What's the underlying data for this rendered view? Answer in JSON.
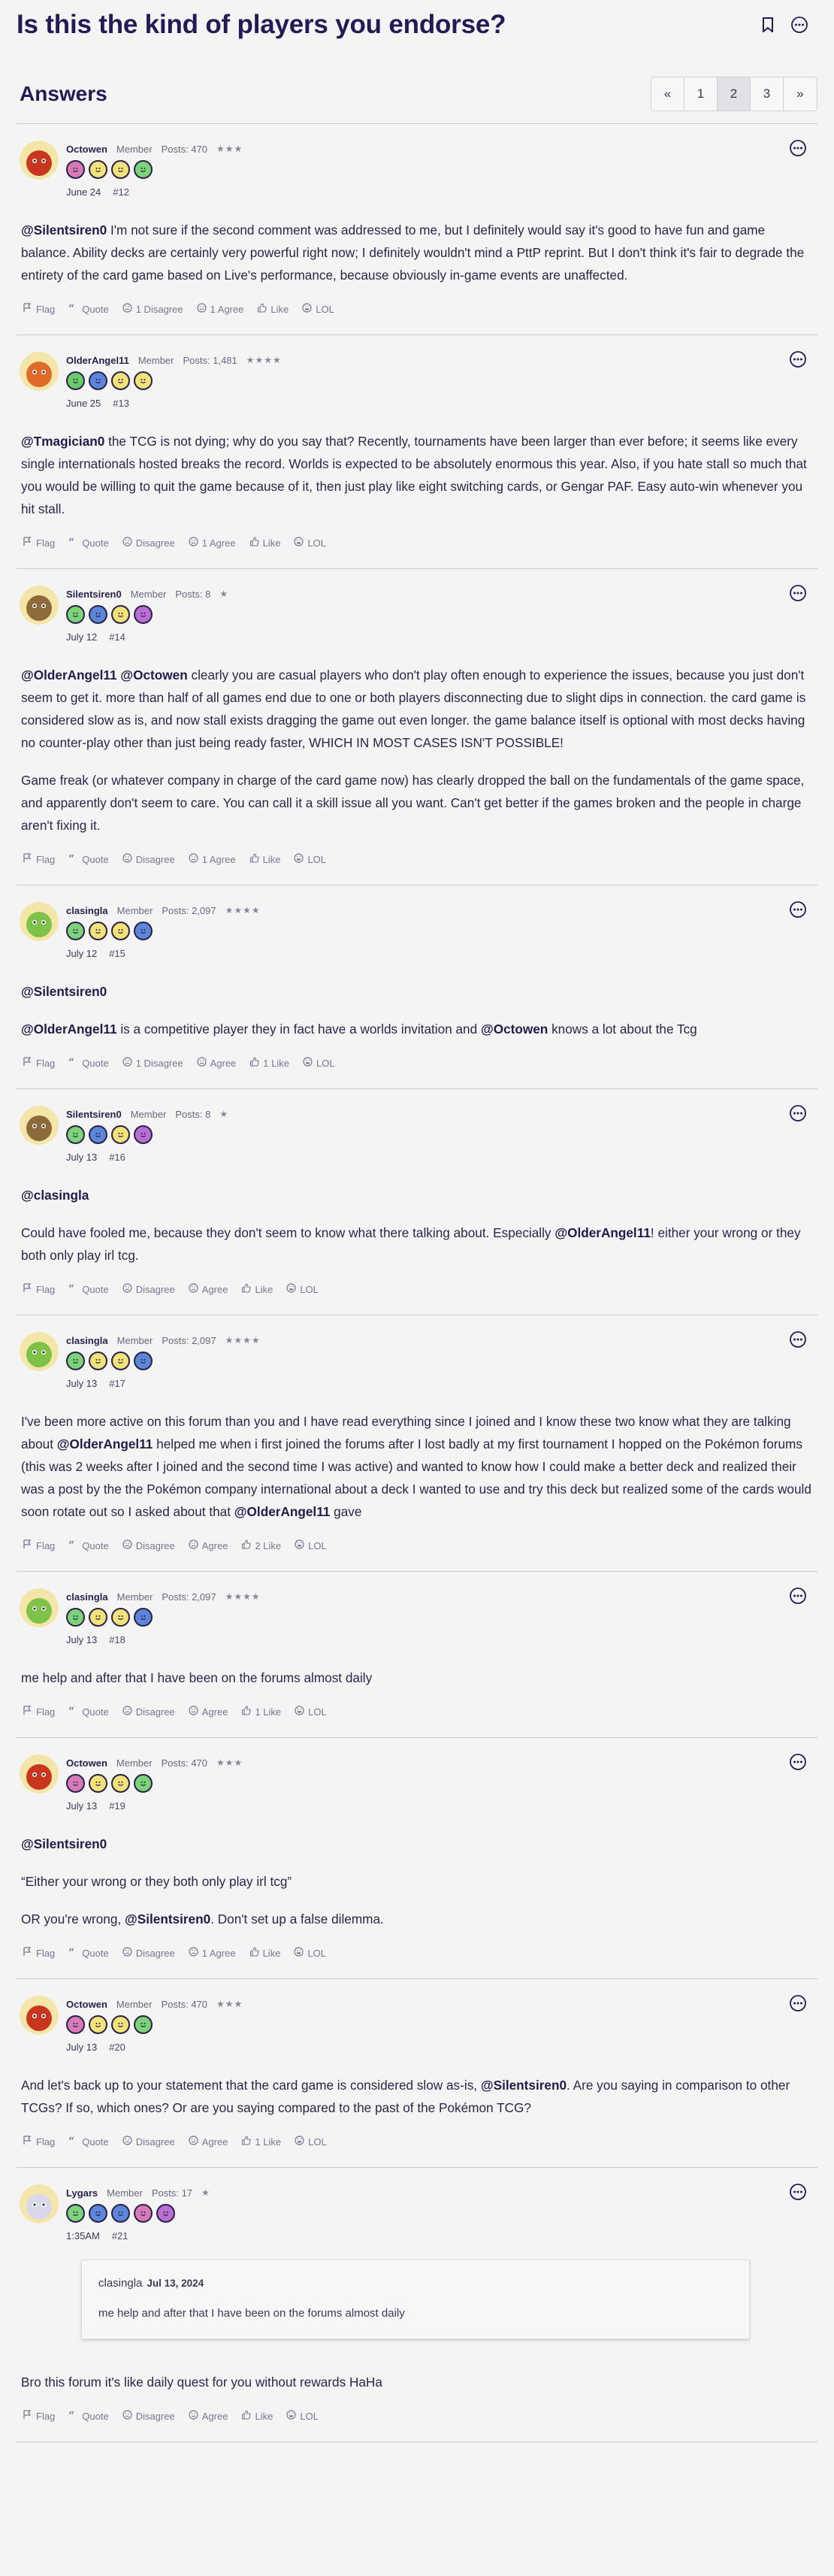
{
  "page": {
    "title": "Is this the kind of players you endorse?",
    "bookmark_icon": "bookmark-icon",
    "more_icon": "more-icon"
  },
  "answers": {
    "heading": "Answers",
    "pager": [
      "«",
      "1",
      "2",
      "3",
      "»"
    ],
    "current_page": "2"
  },
  "colors": {
    "accent": "#261a55",
    "background": "#f4f4f5"
  },
  "posts": [
    {
      "user": "Octowen",
      "role": "Member",
      "posts": "Posts: 470",
      "stars": "★★★",
      "badges": [
        "#d67ab8",
        "#f1e27a",
        "#f1e27a",
        "#7bd37a"
      ],
      "date": "June 24",
      "num": "#12",
      "avatar": "#c9361e",
      "paras": [
        [
          {
            "m": "@Silentsiren0"
          },
          {
            "t": " I'm not sure if the second comment was addressed to me, but I definitely would say it's good to have fun and game balance. Ability decks are certainly very powerful right now; I definitely wouldn't mind a PttP reprint. But I don't think it's fair to degrade the entirety of the card game based on Live's performance, because obviously in-game events are unaffected."
          }
        ]
      ],
      "actions": [
        "Flag",
        "Quote",
        "1 Disagree",
        "1 Agree",
        "Like",
        "LOL"
      ]
    },
    {
      "user": "OlderAngel11",
      "role": "Member",
      "posts": "Posts: 1,481",
      "stars": "★★★★",
      "badges": [
        "#6acb6a",
        "#5b86d9",
        "#f1e27a",
        "#f1e27a"
      ],
      "date": "June 25",
      "num": "#13",
      "avatar": "#e06a2a",
      "paras": [
        [
          {
            "m": "@Tmagician0"
          },
          {
            "t": " the TCG is not dying; why do you say that? Recently, tournaments have been larger than ever before; it seems like every single internationals hosted breaks the record. Worlds is expected to be absolutely enormous this year. Also, if you hate stall so much that you would be willing to quit the game because of it, then just play like eight switching cards, or Gengar PAF. Easy auto-win whenever you hit stall."
          }
        ]
      ],
      "actions": [
        "Flag",
        "Quote",
        "Disagree",
        "1 Agree",
        "Like",
        "LOL"
      ]
    },
    {
      "user": "Silentsiren0",
      "role": "Member",
      "posts": "Posts: 8",
      "stars": "★",
      "badges": [
        "#7bd37a",
        "#5b86d9",
        "#f1e27a",
        "#b96ed3"
      ],
      "date": "July 12",
      "num": "#14",
      "avatar": "#8c6a3a",
      "paras": [
        [
          {
            "m": "@OlderAngel11"
          },
          {
            "t": " "
          },
          {
            "m": "@Octowen"
          },
          {
            "t": " clearly you are casual players who don't play often enough to experience the issues, because you just don't seem to get it. more than half of all games end due to one or both players disconnecting due to slight dips in connection. the card game is considered slow as is, and now stall exists dragging the game out even longer. the game balance itself is optional with most decks having no counter-play other than just being ready faster, WHICH IN MOST CASES ISN'T POSSIBLE!"
          }
        ],
        [
          {
            "t": "Game freak (or whatever company in charge of the card game now) has clearly dropped the ball on the fundamentals of the game space, and apparently don't seem to care. You can call it a skill issue all you want. Can't get better if the games broken and the people in charge aren't fixing it."
          }
        ]
      ],
      "actions": [
        "Flag",
        "Quote",
        "Disagree",
        "1 Agree",
        "Like",
        "LOL"
      ]
    },
    {
      "user": "clasingla",
      "role": "Member",
      "posts": "Posts: 2,097",
      "stars": "★★★★",
      "badges": [
        "#7bd37a",
        "#f1e27a",
        "#f1e27a",
        "#5b86d9"
      ],
      "date": "July 12",
      "num": "#15",
      "avatar": "#7fc24a",
      "paras": [
        [
          {
            "m": "@Silentsiren0"
          }
        ],
        [
          {
            "m": "@OlderAngel11"
          },
          {
            "t": " is a competitive player they in fact have a worlds invitation and "
          },
          {
            "m": "@Octowen"
          },
          {
            "t": " knows a lot about the Tcg"
          }
        ]
      ],
      "actions": [
        "Flag",
        "Quote",
        "1 Disagree",
        "Agree",
        "1 Like",
        "LOL"
      ]
    },
    {
      "user": "Silentsiren0",
      "role": "Member",
      "posts": "Posts: 8",
      "stars": "★",
      "badges": [
        "#7bd37a",
        "#5b86d9",
        "#f1e27a",
        "#b96ed3"
      ],
      "date": "July 13",
      "num": "#16",
      "avatar": "#8c6a3a",
      "paras": [
        [
          {
            "m": "@clasingla"
          }
        ],
        [
          {
            "t": "Could have fooled me, because they don't seem to know what there talking about. Especially "
          },
          {
            "m": "@OlderAngel11"
          },
          {
            "t": "! either your wrong or they both only play irl tcg."
          }
        ]
      ],
      "actions": [
        "Flag",
        "Quote",
        "Disagree",
        "Agree",
        "Like",
        "LOL"
      ]
    },
    {
      "user": "clasingla",
      "role": "Member",
      "posts": "Posts: 2,097",
      "stars": "★★★★",
      "badges": [
        "#7bd37a",
        "#f1e27a",
        "#f1e27a",
        "#5b86d9"
      ],
      "date": "July 13",
      "num": "#17",
      "avatar": "#7fc24a",
      "paras": [
        [
          {
            "t": "I've been more active on this forum than you and I have read everything since I joined and I know these two know what they are talking about "
          },
          {
            "m": "@OlderAngel11"
          },
          {
            "t": " helped me when i first joined the forums after I lost badly at my first tournament I hopped on the Pokémon forums (this was 2 weeks after I joined and the second time I was active) and wanted to know how I could make a better deck and realized their was a post by the the Pokémon company international about a deck I wanted to use and try this deck but realized some of the cards would soon rotate out so I asked about that "
          },
          {
            "m": "@OlderAngel11"
          },
          {
            "t": " gave"
          }
        ]
      ],
      "actions": [
        "Flag",
        "Quote",
        "Disagree",
        "Agree",
        "2 Like",
        "LOL"
      ]
    },
    {
      "user": "clasingla",
      "role": "Member",
      "posts": "Posts: 2,097",
      "stars": "★★★★",
      "badges": [
        "#7bd37a",
        "#f1e27a",
        "#f1e27a",
        "#5b86d9"
      ],
      "date": "July 13",
      "num": "#18",
      "avatar": "#7fc24a",
      "paras": [
        [
          {
            "t": "me help and after that I have been on the forums almost daily"
          }
        ]
      ],
      "actions": [
        "Flag",
        "Quote",
        "Disagree",
        "Agree",
        "1 Like",
        "LOL"
      ]
    },
    {
      "user": "Octowen",
      "role": "Member",
      "posts": "Posts: 470",
      "stars": "★★★",
      "badges": [
        "#d67ab8",
        "#f1e27a",
        "#f1e27a",
        "#7bd37a"
      ],
      "date": "July 13",
      "num": "#19",
      "avatar": "#c9361e",
      "paras": [
        [
          {
            "m": "@Silentsiren0"
          }
        ],
        [
          {
            "t": "“Either your wrong or they both only play irl tcg”"
          }
        ],
        [
          {
            "t": "OR you're wrong, "
          },
          {
            "m": "@Silentsiren0"
          },
          {
            "t": ". Don't set up a false dilemma."
          }
        ]
      ],
      "actions": [
        "Flag",
        "Quote",
        "Disagree",
        "1 Agree",
        "Like",
        "LOL"
      ]
    },
    {
      "user": "Octowen",
      "role": "Member",
      "posts": "Posts: 470",
      "stars": "★★★",
      "badges": [
        "#d67ab8",
        "#f1e27a",
        "#f1e27a",
        "#7bd37a"
      ],
      "date": "July 13",
      "num": "#20",
      "avatar": "#c9361e",
      "paras": [
        [
          {
            "t": "And let's back up to your statement that the card game is considered slow as-is, "
          },
          {
            "m": "@Silentsiren0"
          },
          {
            "t": ". Are you saying in comparison to other TCGs? If so, which ones? Or are you saying compared to the past of the Pokémon TCG?"
          }
        ]
      ],
      "actions": [
        "Flag",
        "Quote",
        "Disagree",
        "Agree",
        "1 Like",
        "LOL"
      ]
    },
    {
      "user": "Lygars",
      "role": "Member",
      "posts": "Posts: 17",
      "stars": "★",
      "badges": [
        "#7bd37a",
        "#5b86d9",
        "#5b86d9",
        "#d67ab8",
        "#b96ed3"
      ],
      "date": "1:35AM",
      "num": "#21",
      "avatar": "#d8d8e8",
      "quote": {
        "author": "clasingla",
        "date": "Jul 13, 2024",
        "text": "me help and after that I have been on the forums almost daily"
      },
      "paras": [
        [
          {
            "t": "Bro this forum it's like daily quest for you without rewards HaHa"
          }
        ]
      ],
      "actions": [
        "Flag",
        "Quote",
        "Disagree",
        "Agree",
        "Like",
        "LOL"
      ]
    }
  ]
}
